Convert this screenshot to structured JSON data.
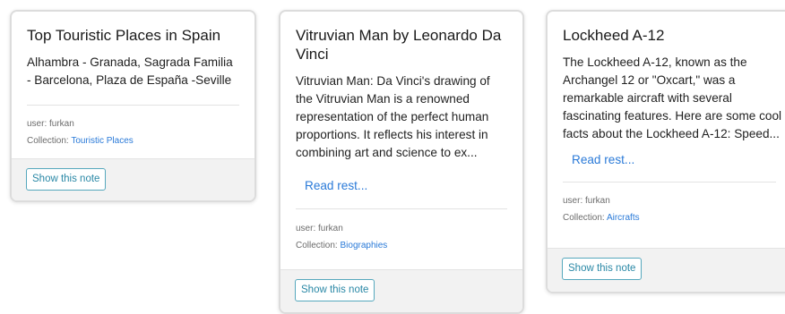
{
  "cards": [
    {
      "title": "Top Touristic Places in Spain",
      "text": "Alhambra - Granada, Sagrada Familia - Barcelona, Plaza de España -Seville",
      "read_more": "",
      "user_label": "user: furkan",
      "collection_label": "Collection:",
      "collection": "Touristic Places",
      "button": "Show this note"
    },
    {
      "title": "Vitruvian Man by Leonardo Da Vinci",
      "text": "Vitruvian Man: Da Vinci's drawing of the Vitruvian Man is a renowned representation of the perfect human proportions. It reflects his interest in combining art and science to ex...",
      "read_more": "Read rest...",
      "user_label": "user: furkan",
      "collection_label": "Collection:",
      "collection": "Biographies",
      "button": "Show this note"
    },
    {
      "title": "Lockheed A-12",
      "text": "The Lockheed A-12, known as the Archangel 12 or \"Oxcart,\" was a remarkable aircraft with several fascinating features. Here are some cool facts about the Lockheed A-12: Speed...",
      "read_more": "Read rest...",
      "user_label": "user: furkan",
      "collection_label": "Collection:",
      "collection": "Aircrafts",
      "button": "Show this note"
    }
  ],
  "colors": {
    "link": "#2a7ad8",
    "button_border": "#56a8bd",
    "button_text": "#2a88a6",
    "footer_bg": "#f2f2f2"
  }
}
